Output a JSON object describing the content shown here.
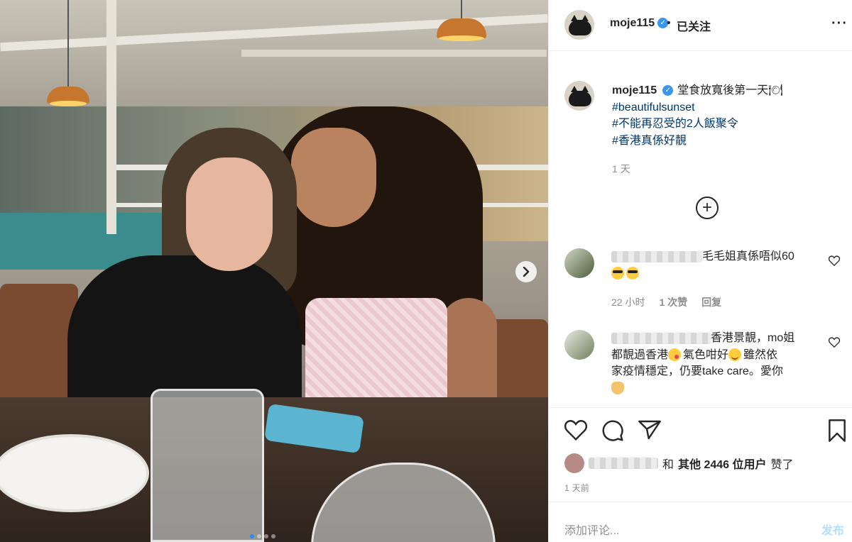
{
  "photo": {
    "carousel_dots": 4,
    "active_dot": 0,
    "next_icon": "chevron-right-icon"
  },
  "header": {
    "username": "moje115",
    "verified_icon": "verified-badge-icon",
    "separator": "•",
    "follow_status": "已关注",
    "more_icon": "more-horizontal-icon"
  },
  "caption": {
    "username": "moje115",
    "text": "堂食放寬後第一天🍽",
    "hashtags": [
      "#beautifulsunset",
      "#不能再忍受的2人飯聚令",
      "#香港真係好靚"
    ],
    "time": "1 天"
  },
  "load_more_icon": "plus-circle-icon",
  "comments": [
    {
      "text": "毛毛姐真係唔似60",
      "emojis": "😎😎",
      "time": "22 小时",
      "likes": "1 次赞",
      "reply": "回复"
    },
    {
      "text_line1": "香港景靚，mo姐",
      "text_line2a": "都靚過香港",
      "text_line2b": "氣色咁好",
      "text_line2c": "雖然依",
      "text_line3": "家疫情穩定，仍要take care。愛你"
    }
  ],
  "actions": {
    "like_icon": "heart-icon",
    "comment_icon": "comment-bubble-icon",
    "share_icon": "paper-plane-icon",
    "save_icon": "bookmark-icon"
  },
  "likes_line": {
    "connector": "和",
    "others": "其他 2446 位用户",
    "suffix": "赞了"
  },
  "post_date": "1 天前",
  "comment_box": {
    "placeholder": "添加评论...",
    "submit": "发布"
  }
}
